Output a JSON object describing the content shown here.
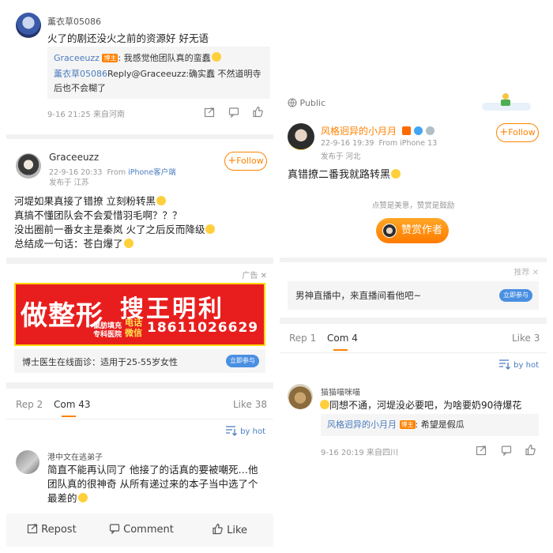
{
  "left": {
    "comment1": {
      "user": "薰衣草05086",
      "text": "火了的剧还没火之前的资源好 好无语",
      "reply1_user": "Graceeuzz",
      "reply1_tag": "博主",
      "reply1_text": ": 我感觉他团队真的蛮蠢",
      "reply2_user": "薰衣草05086",
      "reply2_text": "Reply@Graceeuzz:确实蠢 不然道明寺后也不会糊了",
      "meta": "9-16 21:25  来自河南"
    },
    "post": {
      "user": "Graceeuzz",
      "time": "22-9-16 20:33",
      "source_prefix": "From ",
      "source_link": "iPhone客户端",
      "location": "发布于 江苏",
      "follow": "Follow",
      "lines": [
        "河堤如果真接了错撩 立刻粉转黑",
        "真搞不懂团队会不会爱惜羽毛啊？？？",
        "没出圈前一番女主是秦岚 火了之后反而降级",
        "总结成一句话：苍白爆了"
      ]
    },
    "ad": {
      "label": "广告",
      "close": "✕",
      "banner_big": "做整形",
      "banner_mid": "搜王明利",
      "banner_small1": "鼠肪填充",
      "banner_small2": "专科医院",
      "banner_phone_label1": "电话",
      "banner_phone_label2": "微信",
      "banner_phone": "18611026629",
      "caption": "博士医生在线面诊：适用于25-55岁女性",
      "cta": "立即参与"
    },
    "tabs": {
      "rep": "Rep 2",
      "com": "Com 43",
      "like": "Like 38"
    },
    "sort": "by hot",
    "comment2": {
      "user": "港中文在逃弟子",
      "text": "简直不能再认同了 他接了的话真的要被嘲死…他团队真的很神奇 从所有递过来的本子当中选了个最差的"
    },
    "actions": {
      "repost": "Repost",
      "comment": "Comment",
      "like": "Like"
    }
  },
  "right": {
    "public": "Public",
    "post": {
      "user": "风格迥异的小月月",
      "time": "22-9-16 19:39",
      "source": "From iPhone 13",
      "location": "发布于 河北",
      "follow": "Follow",
      "text": "真错撩二番我就路转黑"
    },
    "reward": {
      "hint": "点赞是美意，赞赏是鼓励",
      "button": "赞赏作者"
    },
    "promo": {
      "label": "推荐",
      "close": "✕",
      "text": "男神直播中，来直播间看他吧~",
      "cta": "立即参与"
    },
    "tabs": {
      "rep": "Rep 1",
      "com": "Com 4",
      "like": "Like 3"
    },
    "sort": "by hot",
    "comment": {
      "user": "猫猫喵咪喵",
      "text": "同想不通，河堤没必要吧，为啥要奶90待爆花",
      "reply_user": "风格迥异的小月月",
      "reply_tag": "博主",
      "reply_text": ": 希望是假瓜",
      "meta": "9-16 20:19  来自四川"
    }
  }
}
